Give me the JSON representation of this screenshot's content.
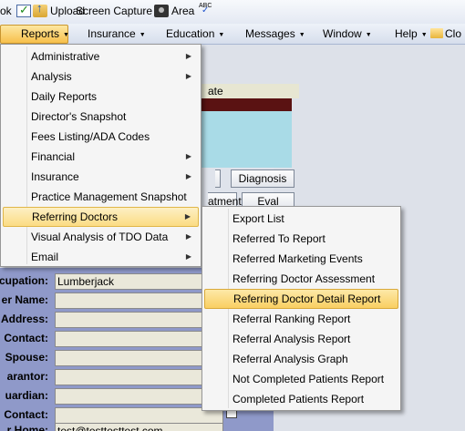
{
  "toolbar": {
    "items": [
      {
        "label": "ok",
        "icon": "checkbox-icon"
      },
      {
        "label": "Upload",
        "icon": "upload-icon"
      },
      {
        "label": "Screen Capture"
      },
      {
        "label": "Area",
        "icon": "camera-icon"
      },
      {
        "label": "",
        "icon": "spellcheck-icon"
      }
    ]
  },
  "menubar": {
    "items": [
      "Reports",
      "Insurance",
      "Education",
      "Messages",
      "Window",
      "Help",
      "Clo"
    ],
    "active": "Reports"
  },
  "reports_menu": {
    "items": [
      {
        "label": "Administrative",
        "submenu": true
      },
      {
        "label": "Analysis",
        "submenu": true
      },
      {
        "label": "Daily Reports",
        "submenu": false
      },
      {
        "label": "Director's Snapshot",
        "submenu": false
      },
      {
        "label": "Fees Listing/ADA Codes",
        "submenu": false
      },
      {
        "label": "Financial",
        "submenu": true
      },
      {
        "label": "Insurance",
        "submenu": true
      },
      {
        "label": "Practice Management Snapshot",
        "submenu": false
      },
      {
        "label": "Referring Doctors",
        "submenu": true
      },
      {
        "label": "Visual Analysis of TDO Data",
        "submenu": true
      },
      {
        "label": "Email",
        "submenu": true
      }
    ],
    "highlighted": "Referring Doctors"
  },
  "referring_doctors_menu": {
    "items": [
      "Export List",
      "Referred To Report",
      "Referred Marketing Events",
      "Referring Doctor Assessment",
      "Referring Doctor Detail Report",
      "Referral Ranking Report",
      "Referral Analysis Report",
      "Referral Analysis Graph",
      "Not Completed Patients Report",
      "Completed Patients Report"
    ],
    "highlighted": "Referring Doctor Detail Report"
  },
  "background": {
    "date_header": "ate",
    "buttons": {
      "diagnosis": "Diagnosis",
      "treatment": "atment",
      "eval": "Eval"
    },
    "fields": [
      {
        "label": "cupation:",
        "value": "Lumberjack"
      },
      {
        "label": "er Name:",
        "value": ""
      },
      {
        "label": "Address:",
        "value": ""
      },
      {
        "label": "Contact:",
        "value": ""
      },
      {
        "label": "Spouse:",
        "value": ""
      },
      {
        "label": "arantor:",
        "value": ""
      },
      {
        "label": "uardian:",
        "value": ""
      },
      {
        "label": "Contact:",
        "value": ""
      },
      {
        "label": "r Home:",
        "value": "test@testtesttest.com"
      }
    ]
  },
  "colors": {
    "app_background": "#8f99c9",
    "menu_highlight": "#fbdc83",
    "maroon_bar": "#5a1212",
    "cyan_box": "#a9dbe7"
  }
}
